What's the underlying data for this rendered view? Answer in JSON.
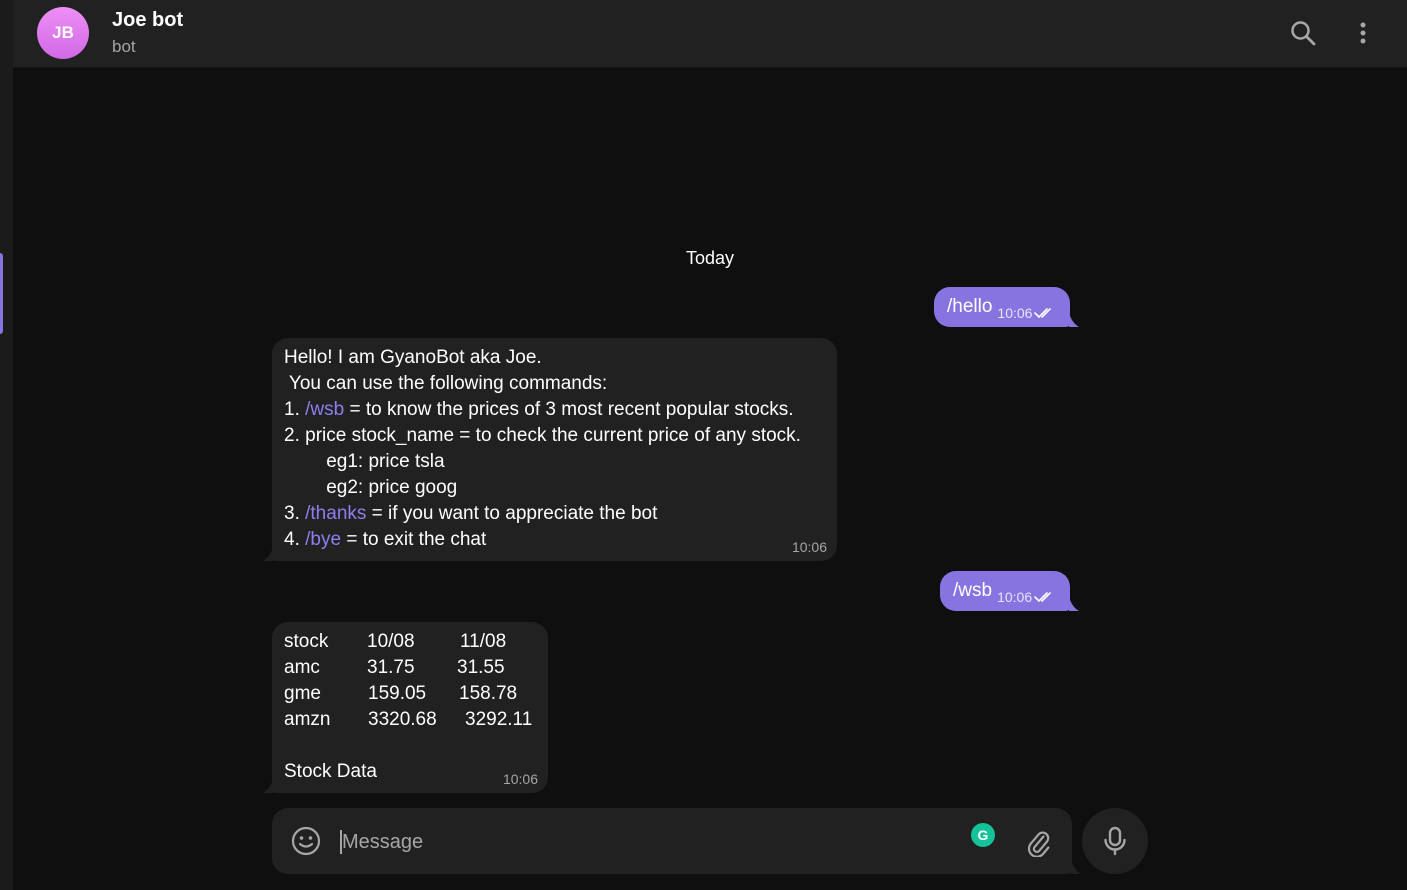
{
  "header": {
    "avatar_initials": "JB",
    "title": "Joe bot",
    "subtitle": "bot",
    "icons": [
      "search-icon",
      "more-vertical-icon"
    ]
  },
  "chat": {
    "date_label": "Today",
    "messages": [
      {
        "type": "outgoing",
        "text": "/hello",
        "time": "10:06",
        "status": "read"
      },
      {
        "type": "incoming",
        "time": "10:06",
        "lines": [
          "Hello! I am GyanoBot aka Joe.",
          " You can use the following commands:",
          "1. /wsb = to know the prices of 3 most recent popular stocks.",
          "2. price stock_name = to check the current price of any stock.",
          "        eg1: price tsla",
          "        eg2: price goog",
          "3. /thanks = if you want to appreciate the bot",
          "4. /bye = to exit the chat"
        ]
      },
      {
        "type": "outgoing",
        "text": "/wsb",
        "time": "10:06",
        "status": "read"
      },
      {
        "type": "incoming",
        "time": "10:06",
        "table_header": [
          "stock",
          "10/08",
          "11/08"
        ],
        "rows": [
          [
            "amc",
            "31.75",
            "31.55"
          ],
          [
            "gme",
            "159.05",
            "158.78"
          ],
          [
            "amzn",
            "3320.68",
            "3292.11"
          ]
        ],
        "footer": "Stock Data"
      }
    ]
  },
  "composer": {
    "placeholder": "Message",
    "grammarly_letter": "G",
    "icons": [
      "smile-icon",
      "grammarly-icon",
      "paperclip-icon",
      "microphone-icon"
    ]
  },
  "colors": {
    "accent": "#8774e1",
    "background": "#0f0f0f",
    "panel": "#212121",
    "muted_text": "#a6a6a6",
    "command_link": "#8d7ff0",
    "avatar": "#e27ef2"
  }
}
